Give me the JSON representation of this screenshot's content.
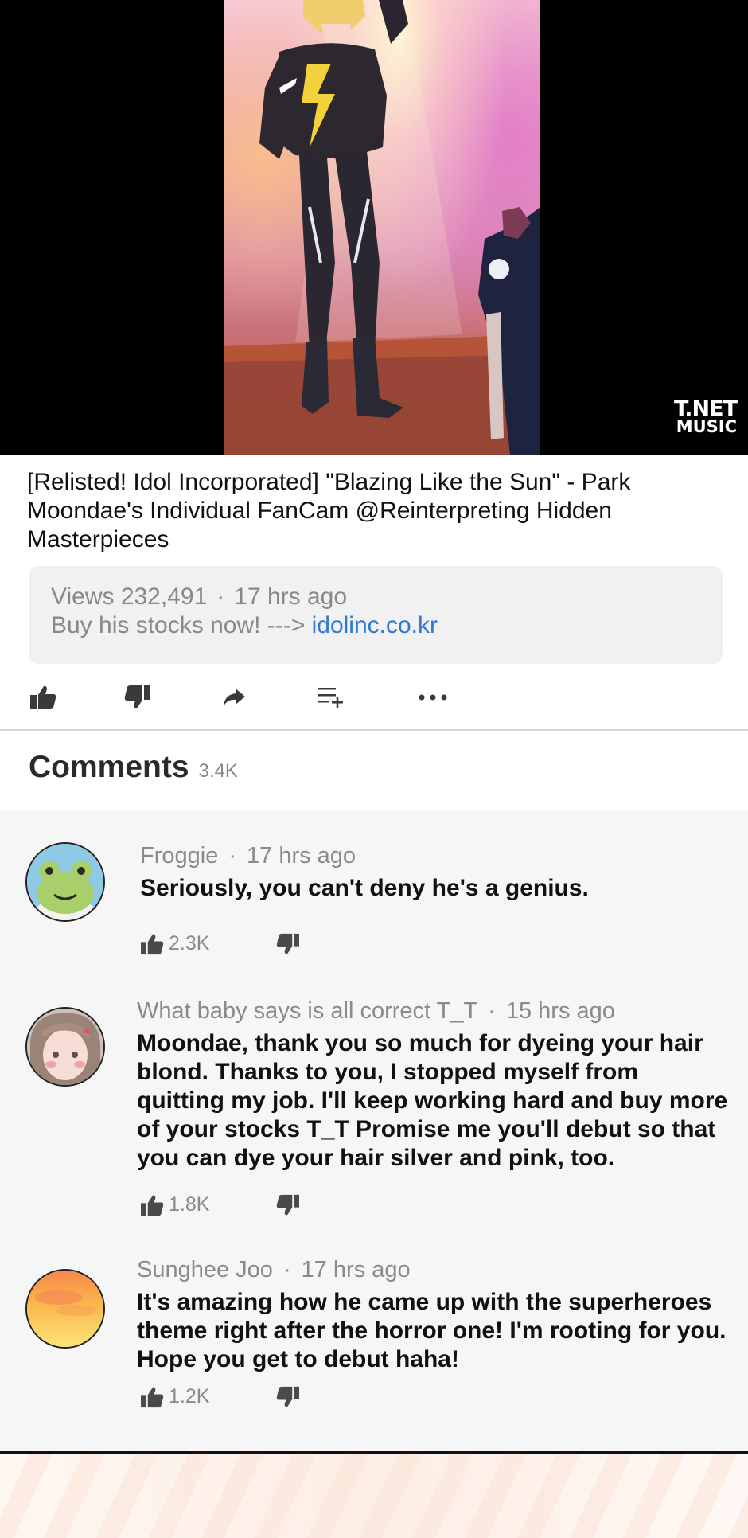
{
  "video": {
    "brand_line1": "T.NET",
    "brand_line2": "MUSIC"
  },
  "title": "[Relisted! Idol Incorporated] \"Blazing Like the Sun\" - Park Moondae's Individual FanCam @Reinterpreting Hidden Masterpieces",
  "info": {
    "views_label": "Views 232,491",
    "separator": "·",
    "time": "17 hrs ago",
    "promo_text": "Buy his stocks now! --->",
    "promo_link": "idolinc.co.kr",
    "link_color": "#2f7ad1"
  },
  "actions": [
    {
      "icon": "thumbs-up-icon"
    },
    {
      "icon": "thumbs-down-icon"
    },
    {
      "icon": "share-icon"
    },
    {
      "icon": "add-to-playlist-icon"
    },
    {
      "icon": "more-icon"
    }
  ],
  "comments": {
    "title": "Comments",
    "count": "3.4K",
    "items": [
      {
        "author": "Froggie",
        "separator": "·",
        "time": "17 hrs ago",
        "text": "Seriously, you can't deny he's a genius.",
        "likes": "2.3K",
        "avatar": "frog-avatar"
      },
      {
        "author": "What baby says is all correct T_T",
        "separator": "·",
        "time": "15 hrs ago",
        "text": "Moondae, thank you so much for dyeing your hair blond. Thanks to you, I stopped myself from quitting my job. I'll keep working hard and buy more of your stocks T_T Promise me you'll debut so that you can dye your hair silver and pink, too.",
        "likes": "1.8K",
        "avatar": "character-avatar"
      },
      {
        "author": "Sunghee Joo",
        "separator": "·",
        "time": "17 hrs ago",
        "text": "It's amazing how he came up with the superheroes theme right after the horror one! I'm rooting for you. Hope you get to debut haha!",
        "likes": "1.2K",
        "avatar": "sunset-avatar"
      }
    ]
  }
}
